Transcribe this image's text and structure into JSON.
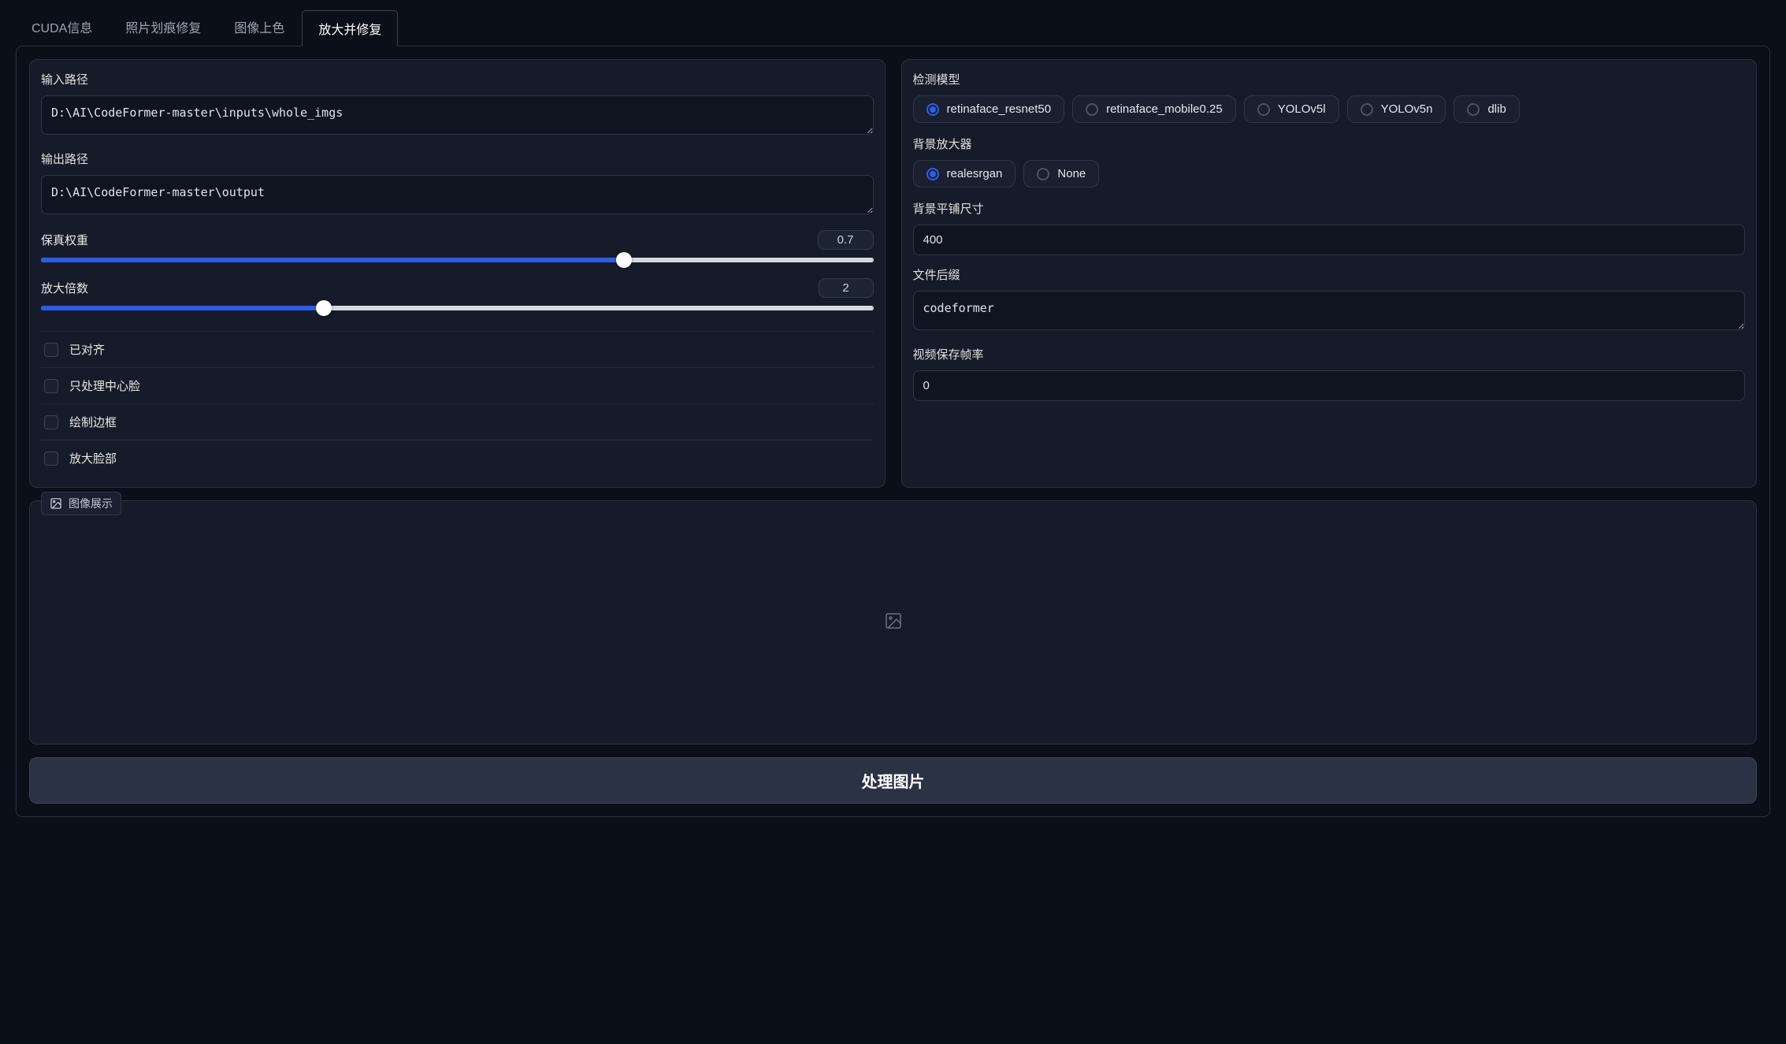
{
  "tabs": [
    {
      "label": "CUDA信息",
      "active": false
    },
    {
      "label": "照片划痕修复",
      "active": false
    },
    {
      "label": "图像上色",
      "active": false
    },
    {
      "label": "放大并修复",
      "active": true
    }
  ],
  "left": {
    "input_path": {
      "label": "输入路径",
      "value": "D:\\AI\\CodeFormer-master\\inputs\\whole_imgs"
    },
    "output_path": {
      "label": "输出路径",
      "value": "D:\\AI\\CodeFormer-master\\output"
    },
    "fidelity": {
      "label": "保真权重",
      "value": "0.7",
      "percent": 70
    },
    "upscale": {
      "label": "放大倍数",
      "value": "2",
      "percent": 34
    },
    "checks": [
      {
        "label": "已对齐"
      },
      {
        "label": "只处理中心脸"
      },
      {
        "label": "绘制边框"
      },
      {
        "label": "放大脸部"
      }
    ]
  },
  "right": {
    "detection_label": "检测模型",
    "detection_options": [
      {
        "label": "retinaface_resnet50",
        "selected": true
      },
      {
        "label": "retinaface_mobile0.25",
        "selected": false
      },
      {
        "label": "YOLOv5l",
        "selected": false
      },
      {
        "label": "YOLOv5n",
        "selected": false
      },
      {
        "label": "dlib",
        "selected": false
      }
    ],
    "bg_upsampler_label": "背景放大器",
    "bg_upsampler_options": [
      {
        "label": "realesrgan",
        "selected": true
      },
      {
        "label": "None",
        "selected": false
      }
    ],
    "bg_tile": {
      "label": "背景平铺尺寸",
      "value": "400"
    },
    "suffix": {
      "label": "文件后缀",
      "value": "codeformer"
    },
    "fps": {
      "label": "视频保存帧率",
      "value": "0"
    }
  },
  "image_section": {
    "label": "图像展示"
  },
  "process_label": "处理图片"
}
